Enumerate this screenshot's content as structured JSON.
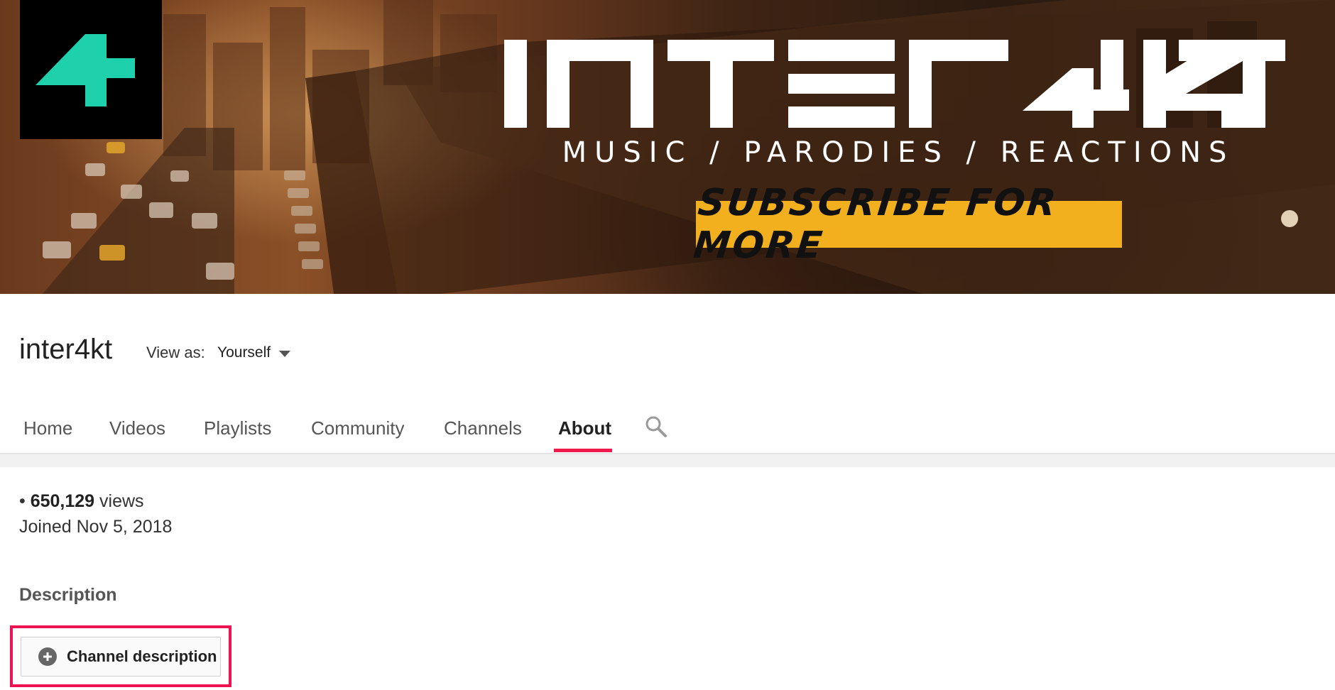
{
  "banner": {
    "wordmark": "INTER4KT",
    "tagline": "MUSIC / PARODIES / REACTIONS",
    "subscribe_text": "SUBSCRIBE FOR MORE",
    "colors": {
      "accent_yellow": "#f2b01e",
      "logo_teal": "#1ed1ac"
    }
  },
  "channel": {
    "name": "inter4kt",
    "view_as_label": "View as:",
    "view_as_value": "Yourself"
  },
  "tabs": [
    {
      "label": "Home"
    },
    {
      "label": "Videos"
    },
    {
      "label": "Playlists"
    },
    {
      "label": "Community"
    },
    {
      "label": "Channels"
    },
    {
      "label": "About",
      "active": true
    }
  ],
  "search_icon": "search-icon",
  "about": {
    "views_bullet": "•",
    "views_count": "650,129",
    "views_suffix": "views",
    "joined": "Joined Nov 5, 2018",
    "description_heading": "Description",
    "description_button": "Channel description"
  },
  "colors": {
    "active_tab_underline": "#f0194d",
    "highlight_frame": "#ee1452"
  }
}
